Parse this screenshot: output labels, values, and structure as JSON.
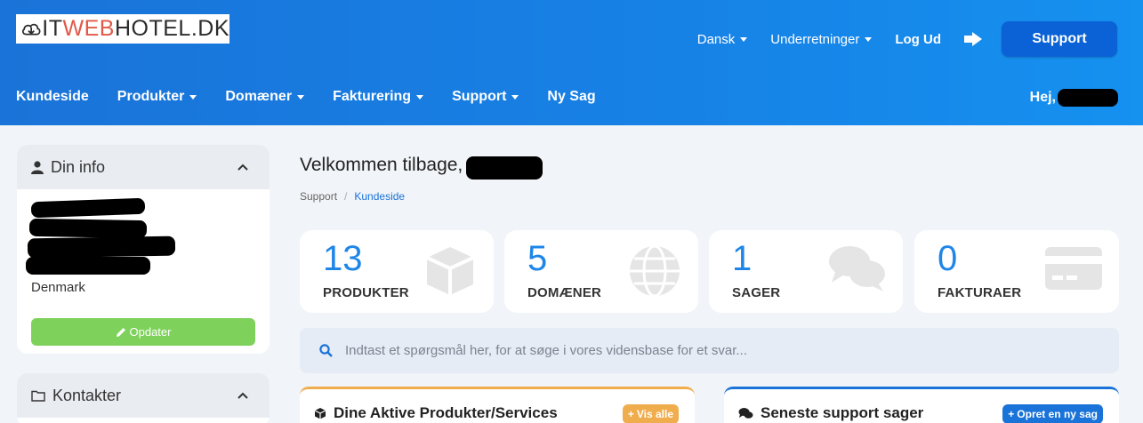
{
  "logo": {
    "it": "IT",
    "web": "WEB",
    "rest": "HOTEL.DK"
  },
  "top_links": {
    "language": "Dansk",
    "notifications": "Underretninger",
    "logout": "Log Ud",
    "support_button": "Support"
  },
  "nav": {
    "items": [
      {
        "label": "Kundeside",
        "dropdown": false
      },
      {
        "label": "Produkter",
        "dropdown": true
      },
      {
        "label": "Domæner",
        "dropdown": true
      },
      {
        "label": "Fakturering",
        "dropdown": true
      },
      {
        "label": "Support",
        "dropdown": true
      },
      {
        "label": "Ny Sag",
        "dropdown": false
      }
    ],
    "greeting": "Hej,"
  },
  "sidebar": {
    "info_title": "Din info",
    "country": "Denmark",
    "update_button": "Opdater",
    "contacts_title": "Kontakter"
  },
  "main": {
    "welcome": "Velkommen tilbage,",
    "breadcrumb": [
      "Support",
      "Kundeside"
    ],
    "stats": [
      {
        "value": "13",
        "label": "PRODUKTER",
        "icon": "cube-icon"
      },
      {
        "value": "5",
        "label": "DOMÆNER",
        "icon": "globe-icon"
      },
      {
        "value": "1",
        "label": "SAGER",
        "icon": "comments-icon"
      },
      {
        "value": "0",
        "label": "FAKTURAER",
        "icon": "credit-card-icon"
      }
    ],
    "search_placeholder": "Indtast et spørgsmål her, for at søge i vores vidensbase for et svar...",
    "panels": {
      "products_title": "Dine Aktive Produkter/Services",
      "products_badge": "Vis alle",
      "tickets_title": "Seneste support sager",
      "tickets_badge": "Opret en ny sag"
    }
  },
  "colors": {
    "brand_blue": "#1a73d8",
    "support_button": "#0b62d6",
    "update_green": "#7ed25b",
    "products_accent": "#f0ad4e",
    "tickets_accent": "#1a73d8"
  }
}
